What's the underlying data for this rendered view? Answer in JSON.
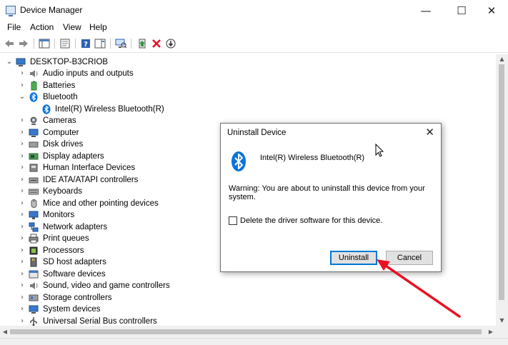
{
  "window": {
    "title": "Device Manager",
    "minimize_glyph": "—",
    "maximize_glyph": "☐",
    "close_glyph": "✕"
  },
  "menu": {
    "items": [
      "File",
      "Action",
      "View",
      "Help"
    ]
  },
  "toolbar": {
    "icons": [
      "back-arrow-icon",
      "forward-arrow-icon",
      "show-hide-console-tree-icon",
      "properties-icon",
      "help-icon",
      "action-pane-icon",
      "scan-hardware-icon",
      "update-driver-icon",
      "uninstall-device-icon",
      "disable-device-icon"
    ],
    "uninstall_color": "#e81123"
  },
  "tree": {
    "root": "DESKTOP-B3CRIOB",
    "items": [
      {
        "label": "Audio inputs and outputs",
        "icon": "speaker-icon",
        "expanded": false
      },
      {
        "label": "Batteries",
        "icon": "battery-icon",
        "expanded": false
      },
      {
        "label": "Bluetooth",
        "icon": "bluetooth-icon",
        "expanded": true,
        "children": [
          {
            "label": "Intel(R) Wireless Bluetooth(R)",
            "icon": "bluetooth-icon"
          }
        ]
      },
      {
        "label": "Cameras",
        "icon": "camera-icon",
        "expanded": false
      },
      {
        "label": "Computer",
        "icon": "computer-icon",
        "expanded": false
      },
      {
        "label": "Disk drives",
        "icon": "disk-drive-icon",
        "expanded": false
      },
      {
        "label": "Display adapters",
        "icon": "display-adapter-icon",
        "expanded": false
      },
      {
        "label": "Human Interface Devices",
        "icon": "hid-icon",
        "expanded": false
      },
      {
        "label": "IDE ATA/ATAPI controllers",
        "icon": "ide-controller-icon",
        "expanded": false
      },
      {
        "label": "Keyboards",
        "icon": "keyboard-icon",
        "expanded": false
      },
      {
        "label": "Mice and other pointing devices",
        "icon": "mouse-icon",
        "expanded": false
      },
      {
        "label": "Monitors",
        "icon": "monitor-icon",
        "expanded": false
      },
      {
        "label": "Network adapters",
        "icon": "network-adapter-icon",
        "expanded": false
      },
      {
        "label": "Print queues",
        "icon": "printer-icon",
        "expanded": false
      },
      {
        "label": "Processors",
        "icon": "processor-icon",
        "expanded": false
      },
      {
        "label": "SD host adapters",
        "icon": "sd-card-icon",
        "expanded": false
      },
      {
        "label": "Software devices",
        "icon": "software-device-icon",
        "expanded": false
      },
      {
        "label": "Sound, video and game controllers",
        "icon": "sound-controller-icon",
        "expanded": false
      },
      {
        "label": "Storage controllers",
        "icon": "storage-controller-icon",
        "expanded": false
      },
      {
        "label": "System devices",
        "icon": "system-device-icon",
        "expanded": false
      },
      {
        "label": "Universal Serial Bus controllers",
        "icon": "usb-icon",
        "expanded": false
      }
    ]
  },
  "dialog": {
    "title": "Uninstall Device",
    "device_name": "Intel(R) Wireless Bluetooth(R)",
    "warning": "Warning: You are about to uninstall this device from your system.",
    "checkbox_label": "Delete the driver software for this device.",
    "checkbox_checked": false,
    "uninstall_label": "Uninstall",
    "cancel_label": "Cancel",
    "close_glyph": "✕"
  },
  "colors": {
    "accent": "#0078d7",
    "bluetooth": "#0a74da",
    "annotation_arrow": "#e81123"
  }
}
